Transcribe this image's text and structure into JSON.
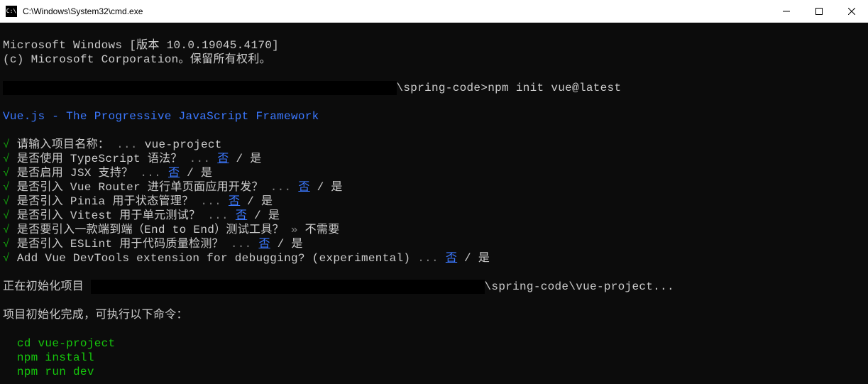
{
  "titlebar": {
    "icon_text": "C:\\",
    "title": "C:\\Windows\\System32\\cmd.exe"
  },
  "header": {
    "line1": "Microsoft Windows [版本 10.0.19045.4170]",
    "line2": "(c) Microsoft Corporation。保留所有权利。"
  },
  "prompt": {
    "suffix": "\\spring-code>",
    "command": "npm init vue@latest"
  },
  "vue_banner": "Vue.js - The Progressive JavaScript Framework",
  "checkmark": "√",
  "dots": "...",
  "arrows": "»",
  "separator": " / ",
  "no_label": "否",
  "yes_label": "是",
  "questions": {
    "project_name": {
      "label": "请输入项目名称：",
      "answer": "vue-project"
    },
    "typescript": {
      "label": "是否使用 TypeScript 语法？"
    },
    "jsx": {
      "label": "是否启用 JSX 支持？"
    },
    "router": {
      "label": "是否引入 Vue Router 进行单页面应用开发？"
    },
    "pinia": {
      "label": "是否引入 Pinia 用于状态管理？"
    },
    "vitest": {
      "label": "是否引入 Vitest 用于单元测试？"
    },
    "e2e": {
      "label": "是否要引入一款端到端（End to End）测试工具？",
      "answer": "不需要"
    },
    "eslint": {
      "label": "是否引入 ESLint 用于代码质量检测？"
    },
    "devtools": {
      "label": "Add Vue DevTools extension for debugging? (experimental)"
    }
  },
  "init": {
    "prefix": "正在初始化项目 ",
    "suffix": "\\spring-code\\vue-project..."
  },
  "done": "项目初始化完成，可执行以下命令：",
  "commands": {
    "cd": "cd vue-project",
    "install": "npm install",
    "dev": "npm run dev"
  }
}
